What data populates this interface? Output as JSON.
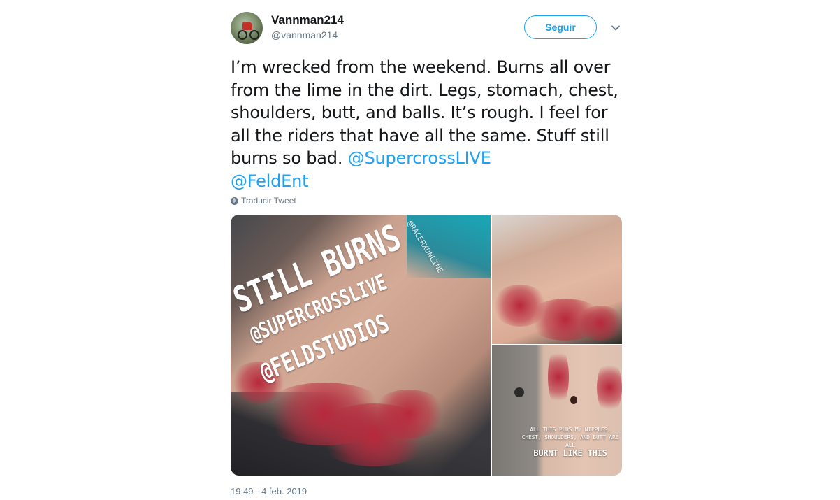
{
  "tweet": {
    "author": {
      "name": "Vannman214",
      "handle": "@vannman214"
    },
    "follow_label": "Seguir",
    "text": "I’m wrecked from the weekend. Burns all over from the lime in the dirt. Legs, stomach, chest, shoulders, butt, and balls. It’s rough. I feel for all the riders that have all the same. Stuff still burns so bad. ",
    "mentions": [
      "@SupercrossLIVE",
      "@FeldEnt"
    ],
    "translate_label": "Traducir Tweet",
    "media": {
      "photo1": {
        "line1": "STILL BURNS",
        "line2": "@SUPERCROSSLIVE",
        "line3": "@FELDSTUDIOS",
        "watermark": "@RACERXONLINE"
      },
      "photo3": {
        "caption": "ALL THIS PLUS MY NIPPLES, CHEST, SHOULDERS, AND BUTT ARE ALL",
        "caption_big": "BURNT LIKE THIS"
      }
    },
    "timestamp": "19:49 - 4 feb. 2019"
  },
  "colors": {
    "link": "#1da1f2",
    "text": "#14171a",
    "secondary": "#657786"
  },
  "icons": {
    "avatar": "motocross-rider-avatar",
    "caret": "chevron-down-icon",
    "translate": "globe-icon"
  }
}
